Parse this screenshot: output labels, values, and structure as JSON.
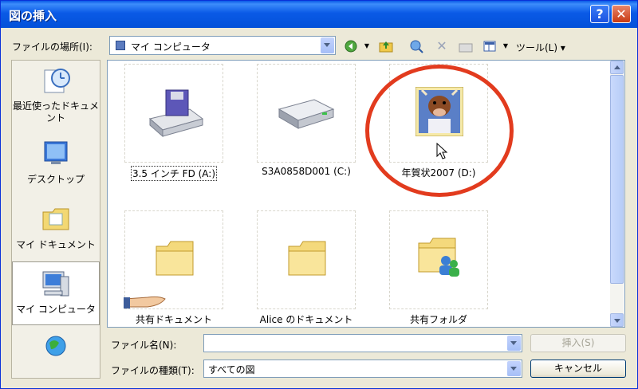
{
  "window": {
    "title": "図の挿入",
    "help_label": "?",
    "close_label": "✕"
  },
  "lookin": {
    "label": "ファイルの場所(I):",
    "value": "マイ コンピュータ"
  },
  "toolbar": {
    "tools_label": "ツール(L) ▾"
  },
  "places": [
    {
      "label": "最近使ったドキュメント",
      "icon": "recent-documents-icon"
    },
    {
      "label": "デスクトップ",
      "icon": "desktop-icon"
    },
    {
      "label": "マイ ドキュメント",
      "icon": "my-documents-icon"
    },
    {
      "label": "マイ コンピュータ",
      "icon": "my-computer-icon"
    },
    {
      "label": "",
      "icon": "network-places-icon"
    }
  ],
  "items": [
    {
      "label": "3.5 インチ FD (A:)"
    },
    {
      "label": "S3A0858D001 (C:)"
    },
    {
      "label": "年賀状2007 (D:)"
    },
    {
      "label": "共有ドキュメント"
    },
    {
      "label": "Alice のドキュメント"
    },
    {
      "label": "共有フォルダ"
    }
  ],
  "filename": {
    "label": "ファイル名(N):",
    "value": ""
  },
  "filetype": {
    "label": "ファイルの種類(T):",
    "value": "すべての図"
  },
  "buttons": {
    "insert_label": "挿入(S)",
    "cancel_label": "キャンセル"
  },
  "colors": {
    "titlebar": "#0a5ae6",
    "highlight_circle": "#e23b1e",
    "dialog_bg": "#ece9d8"
  }
}
